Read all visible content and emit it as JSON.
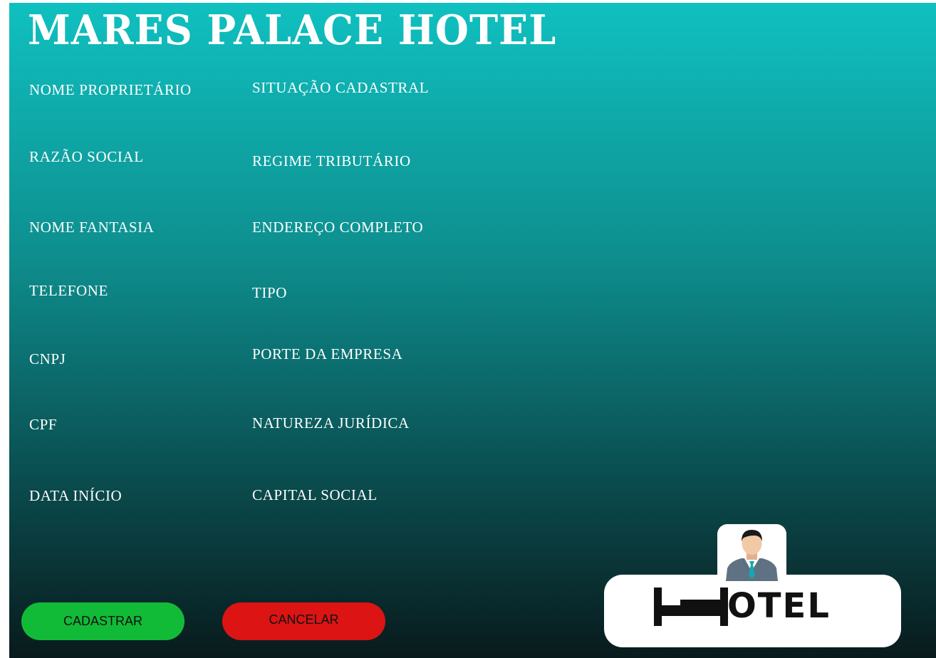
{
  "app": {
    "title": "MARES PALACE HOTEL"
  },
  "form": {
    "left_labels": [
      "NOME PROPRIETÁRIO",
      "RAZÃO SOCIAL",
      "NOME FANTASIA",
      "TELEFONE",
      "CNPJ",
      "CPF",
      "DATA INÍCIO"
    ],
    "right_labels": [
      "SITUAÇÃO CADASTRAL",
      "REGIME TRIBUTÁRIO",
      "ENDEREÇO  COMPLETO",
      "TIPO",
      "PORTE DA EMPRESA",
      "NATUREZA JURÍDICA",
      "CAPITAL SOCIAL"
    ]
  },
  "actions": {
    "register_label": "CADASTRAR",
    "cancel_label": "CANCELAR"
  },
  "logo": {
    "text": "OTEL",
    "icon": "bed-h-icon"
  },
  "avatar": {
    "icon": "businessman-avatar-icon"
  },
  "colors": {
    "background_top": "#10c0c0",
    "background_bottom": "#091a1c",
    "register_button": "#12bb37",
    "cancel_button": "#dc1414",
    "label_text": "#ffffff"
  }
}
